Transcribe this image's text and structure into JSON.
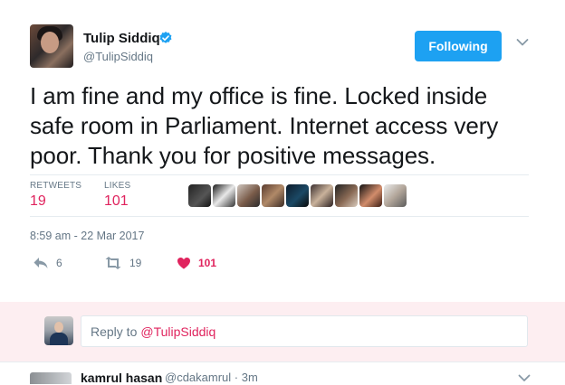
{
  "tweet": {
    "author_name": "Tulip Siddiq",
    "author_handle": "@TulipSiddiq",
    "follow_label": "Following",
    "text": "I am fine and my office is fine. Locked inside safe room in Parliament. Internet access very poor. Thank you for positive messages.",
    "stats": {
      "retweets_label": "RETWEETS",
      "retweets_value": "19",
      "likes_label": "LIKES",
      "likes_value": "101"
    },
    "liker_avatar_count": 9,
    "timestamp": "8:59 am - 22 Mar 2017",
    "actions": {
      "reply_count": "6",
      "retweet_count": "19",
      "like_count": "101"
    }
  },
  "reply_box": {
    "prefix": "Reply to",
    "mention": "@TulipSiddiq"
  },
  "next_tweet": {
    "author_name": "kamrul hasan",
    "meta": "@cdakamrul · 3m"
  },
  "colors": {
    "brand_blue": "#1da1f2",
    "like_pink": "#e0245e",
    "muted": "#657786",
    "reply_bg": "#fdeef1"
  },
  "icons": [
    "verified-badge-icon",
    "chevron-down-icon",
    "reply-icon",
    "retweet-icon",
    "heart-icon"
  ]
}
